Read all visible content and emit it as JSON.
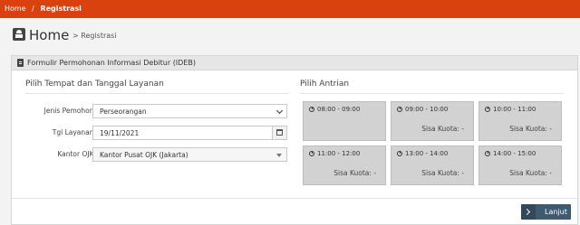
{
  "breadcrumb": {
    "home": "Home",
    "separator": "/",
    "current": "Registrasi"
  },
  "page": {
    "title": "Home",
    "subtitle": "> Registrasi"
  },
  "panel": {
    "title": "Formulir Permohonan Informasi Debitur (IDEB)"
  },
  "form": {
    "section_title": "Pilih Tempat dan Tanggal Layanan",
    "required_mark": "*",
    "fields": {
      "jenis_pemohon": {
        "label": "Jenis Pemohon",
        "value": "Perseorangan"
      },
      "tgl_layanan": {
        "label": "Tgl Layanan",
        "value": "19/11/2021"
      },
      "kantor_ojk": {
        "label": "Kantor OJK",
        "value": "Kantor Pusat OJK (Jakarta)"
      }
    }
  },
  "queue": {
    "section_title": "Pilih Antrian",
    "slots": [
      {
        "time": "08:00 - 09:00",
        "quota": ""
      },
      {
        "time": "09:00 - 10:00",
        "quota": "Sisa Kuota: -"
      },
      {
        "time": "10:00 - 11:00",
        "quota": "Sisa Kuota: -"
      },
      {
        "time": "11:00 - 12:00",
        "quota": "Sisa Kuota: -"
      },
      {
        "time": "13:00 - 14:00",
        "quota": "Sisa Kuota: -"
      },
      {
        "time": "14:00 - 15:00",
        "quota": "Sisa Kuota: -"
      }
    ]
  },
  "actions": {
    "next_label": "Lanjut"
  },
  "colors": {
    "topbar": "#d9410e",
    "slot_bg": "#d2d2d2",
    "button": "#3d5a70"
  }
}
